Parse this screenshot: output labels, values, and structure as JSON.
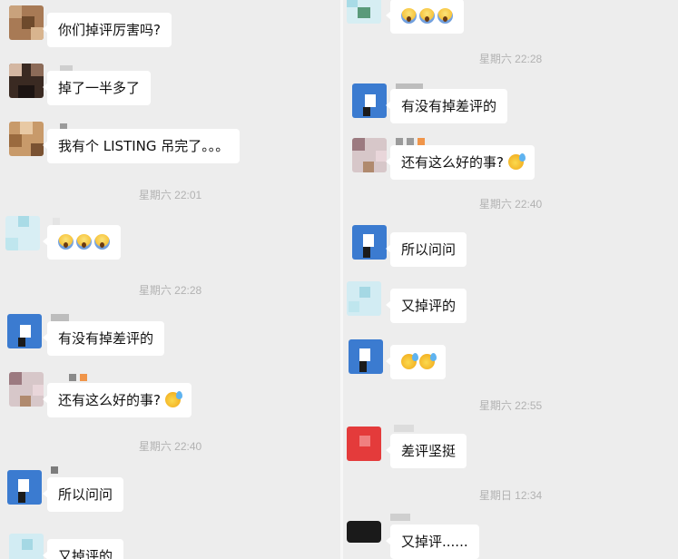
{
  "left": {
    "messages": [
      {
        "text": "你们掉评厉害吗?"
      },
      {
        "text": "掉了一半多了"
      },
      {
        "text": "我有个 LISTING 吊完了。。。"
      },
      {
        "emoji": [
          "scream-emoji",
          "scream-emoji",
          "scream-emoji"
        ]
      },
      {
        "text": "有没有掉差评的"
      },
      {
        "text": "还有这么好的事?",
        "emoji": [
          "sweat-emoji"
        ]
      },
      {
        "text": "所以问问"
      },
      {
        "text": "又掉评的"
      }
    ],
    "timestamps": [
      "星期六 22:01",
      "星期六 22:28",
      "星期六 22:40"
    ]
  },
  "right": {
    "messages": [
      {
        "emoji": [
          "scream-emoji",
          "scream-emoji",
          "scream-emoji"
        ]
      },
      {
        "text": "有没有掉差评的"
      },
      {
        "text": "还有这么好的事?",
        "emoji": [
          "sweat-emoji"
        ]
      },
      {
        "text": "所以问问"
      },
      {
        "text": "又掉评的"
      },
      {
        "emoji": [
          "sweat-emoji",
          "sweat-emoji"
        ]
      },
      {
        "text": "差评坚挺"
      },
      {
        "text": "又掉评......"
      }
    ],
    "timestamps": [
      "星期六 22:28",
      "星期六 22:40",
      "星期六 22:55",
      "星期日 12:34"
    ]
  }
}
